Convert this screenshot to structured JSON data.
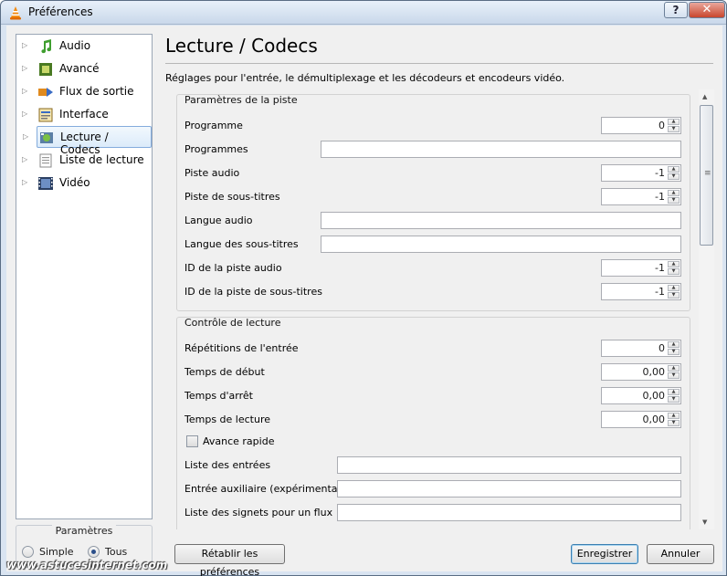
{
  "window": {
    "title": "Préférences",
    "help_label": "?",
    "close_label": "✕"
  },
  "sidebar": {
    "items": [
      {
        "label": "Audio",
        "icon": "music-note-icon"
      },
      {
        "label": "Avancé",
        "icon": "chip-icon"
      },
      {
        "label": "Flux de sortie",
        "icon": "stream-output-icon"
      },
      {
        "label": "Interface",
        "icon": "interface-icon"
      },
      {
        "label": "Lecture / Codecs",
        "icon": "codecs-icon",
        "selected": true
      },
      {
        "label": "Liste de lecture",
        "icon": "playlist-icon"
      },
      {
        "label": "Vidéo",
        "icon": "film-icon"
      }
    ]
  },
  "mode": {
    "title": "Paramètres",
    "simple_label": "Simple",
    "all_label": "Tous",
    "selected": "Tous"
  },
  "main": {
    "title": "Lecture / Codecs",
    "description": "Réglages pour l'entrée, le démultiplexage et les décodeurs et encodeurs vidéo."
  },
  "track_group": {
    "title": "Paramètres de la piste",
    "program_label": "Programme",
    "program_value": "0",
    "programs_label": "Programmes",
    "programs_value": "",
    "audio_track_label": "Piste audio",
    "audio_track_value": "-1",
    "subtitle_track_label": "Piste de sous-titres",
    "subtitle_track_value": "-1",
    "audio_lang_label": "Langue audio",
    "audio_lang_value": "",
    "subtitle_lang_label": "Langue des sous-titres",
    "subtitle_lang_value": "",
    "audio_track_id_label": "ID de la piste audio",
    "audio_track_id_value": "-1",
    "subtitle_track_id_label": "ID de la piste de sous-titres",
    "subtitle_track_id_value": "-1"
  },
  "playback_group": {
    "title": "Contrôle de lecture",
    "repeat_label": "Répétitions de l'entrée",
    "repeat_value": "0",
    "start_label": "Temps de début",
    "start_value": "0,00",
    "stop_label": "Temps d'arrêt",
    "stop_value": "0,00",
    "run_label": "Temps de lecture",
    "run_value": "0,00",
    "fast_forward_label": "Avance rapide",
    "fast_forward_checked": false,
    "input_list_label": "Liste des entrées",
    "input_list_value": "",
    "aux_input_label": "Entrée auxiliaire (expérimental)",
    "aux_input_value": "",
    "bookmarks_label": "Liste des signets pour un flux",
    "bookmarks_value": ""
  },
  "buttons": {
    "reset_label": "Rétablir les préférences",
    "save_label": "Enregistrer",
    "cancel_label": "Annuler"
  },
  "watermark": "www.astucesinternet.com"
}
